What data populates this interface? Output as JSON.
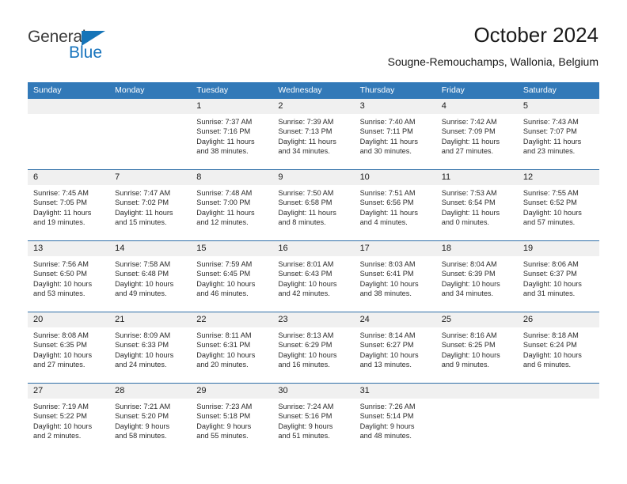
{
  "brand": {
    "name_primary": "General",
    "name_secondary": "Blue",
    "triangle_color": "#1574b8",
    "primary_color": "#3d3d3d",
    "secondary_color": "#1874bd"
  },
  "header": {
    "title": "October 2024",
    "subtitle": "Sougne-Remouchamps, Wallonia, Belgium"
  },
  "theme": {
    "header_blue": "#3279b8",
    "separator_blue": "#2f6fa8",
    "date_band_gray": "#f0f0f0",
    "text_color": "#2b2b2b"
  },
  "weekdays": [
    "Sunday",
    "Monday",
    "Tuesday",
    "Wednesday",
    "Thursday",
    "Friday",
    "Saturday"
  ],
  "weeks": [
    [
      {
        "day": "",
        "sunrise": "",
        "sunset": "",
        "daylight_a": "",
        "daylight_b": ""
      },
      {
        "day": "",
        "sunrise": "",
        "sunset": "",
        "daylight_a": "",
        "daylight_b": ""
      },
      {
        "day": "1",
        "sunrise": "Sunrise: 7:37 AM",
        "sunset": "Sunset: 7:16 PM",
        "daylight_a": "Daylight: 11 hours",
        "daylight_b": "and 38 minutes."
      },
      {
        "day": "2",
        "sunrise": "Sunrise: 7:39 AM",
        "sunset": "Sunset: 7:13 PM",
        "daylight_a": "Daylight: 11 hours",
        "daylight_b": "and 34 minutes."
      },
      {
        "day": "3",
        "sunrise": "Sunrise: 7:40 AM",
        "sunset": "Sunset: 7:11 PM",
        "daylight_a": "Daylight: 11 hours",
        "daylight_b": "and 30 minutes."
      },
      {
        "day": "4",
        "sunrise": "Sunrise: 7:42 AM",
        "sunset": "Sunset: 7:09 PM",
        "daylight_a": "Daylight: 11 hours",
        "daylight_b": "and 27 minutes."
      },
      {
        "day": "5",
        "sunrise": "Sunrise: 7:43 AM",
        "sunset": "Sunset: 7:07 PM",
        "daylight_a": "Daylight: 11 hours",
        "daylight_b": "and 23 minutes."
      }
    ],
    [
      {
        "day": "6",
        "sunrise": "Sunrise: 7:45 AM",
        "sunset": "Sunset: 7:05 PM",
        "daylight_a": "Daylight: 11 hours",
        "daylight_b": "and 19 minutes."
      },
      {
        "day": "7",
        "sunrise": "Sunrise: 7:47 AM",
        "sunset": "Sunset: 7:02 PM",
        "daylight_a": "Daylight: 11 hours",
        "daylight_b": "and 15 minutes."
      },
      {
        "day": "8",
        "sunrise": "Sunrise: 7:48 AM",
        "sunset": "Sunset: 7:00 PM",
        "daylight_a": "Daylight: 11 hours",
        "daylight_b": "and 12 minutes."
      },
      {
        "day": "9",
        "sunrise": "Sunrise: 7:50 AM",
        "sunset": "Sunset: 6:58 PM",
        "daylight_a": "Daylight: 11 hours",
        "daylight_b": "and 8 minutes."
      },
      {
        "day": "10",
        "sunrise": "Sunrise: 7:51 AM",
        "sunset": "Sunset: 6:56 PM",
        "daylight_a": "Daylight: 11 hours",
        "daylight_b": "and 4 minutes."
      },
      {
        "day": "11",
        "sunrise": "Sunrise: 7:53 AM",
        "sunset": "Sunset: 6:54 PM",
        "daylight_a": "Daylight: 11 hours",
        "daylight_b": "and 0 minutes."
      },
      {
        "day": "12",
        "sunrise": "Sunrise: 7:55 AM",
        "sunset": "Sunset: 6:52 PM",
        "daylight_a": "Daylight: 10 hours",
        "daylight_b": "and 57 minutes."
      }
    ],
    [
      {
        "day": "13",
        "sunrise": "Sunrise: 7:56 AM",
        "sunset": "Sunset: 6:50 PM",
        "daylight_a": "Daylight: 10 hours",
        "daylight_b": "and 53 minutes."
      },
      {
        "day": "14",
        "sunrise": "Sunrise: 7:58 AM",
        "sunset": "Sunset: 6:48 PM",
        "daylight_a": "Daylight: 10 hours",
        "daylight_b": "and 49 minutes."
      },
      {
        "day": "15",
        "sunrise": "Sunrise: 7:59 AM",
        "sunset": "Sunset: 6:45 PM",
        "daylight_a": "Daylight: 10 hours",
        "daylight_b": "and 46 minutes."
      },
      {
        "day": "16",
        "sunrise": "Sunrise: 8:01 AM",
        "sunset": "Sunset: 6:43 PM",
        "daylight_a": "Daylight: 10 hours",
        "daylight_b": "and 42 minutes."
      },
      {
        "day": "17",
        "sunrise": "Sunrise: 8:03 AM",
        "sunset": "Sunset: 6:41 PM",
        "daylight_a": "Daylight: 10 hours",
        "daylight_b": "and 38 minutes."
      },
      {
        "day": "18",
        "sunrise": "Sunrise: 8:04 AM",
        "sunset": "Sunset: 6:39 PM",
        "daylight_a": "Daylight: 10 hours",
        "daylight_b": "and 34 minutes."
      },
      {
        "day": "19",
        "sunrise": "Sunrise: 8:06 AM",
        "sunset": "Sunset: 6:37 PM",
        "daylight_a": "Daylight: 10 hours",
        "daylight_b": "and 31 minutes."
      }
    ],
    [
      {
        "day": "20",
        "sunrise": "Sunrise: 8:08 AM",
        "sunset": "Sunset: 6:35 PM",
        "daylight_a": "Daylight: 10 hours",
        "daylight_b": "and 27 minutes."
      },
      {
        "day": "21",
        "sunrise": "Sunrise: 8:09 AM",
        "sunset": "Sunset: 6:33 PM",
        "daylight_a": "Daylight: 10 hours",
        "daylight_b": "and 24 minutes."
      },
      {
        "day": "22",
        "sunrise": "Sunrise: 8:11 AM",
        "sunset": "Sunset: 6:31 PM",
        "daylight_a": "Daylight: 10 hours",
        "daylight_b": "and 20 minutes."
      },
      {
        "day": "23",
        "sunrise": "Sunrise: 8:13 AM",
        "sunset": "Sunset: 6:29 PM",
        "daylight_a": "Daylight: 10 hours",
        "daylight_b": "and 16 minutes."
      },
      {
        "day": "24",
        "sunrise": "Sunrise: 8:14 AM",
        "sunset": "Sunset: 6:27 PM",
        "daylight_a": "Daylight: 10 hours",
        "daylight_b": "and 13 minutes."
      },
      {
        "day": "25",
        "sunrise": "Sunrise: 8:16 AM",
        "sunset": "Sunset: 6:25 PM",
        "daylight_a": "Daylight: 10 hours",
        "daylight_b": "and 9 minutes."
      },
      {
        "day": "26",
        "sunrise": "Sunrise: 8:18 AM",
        "sunset": "Sunset: 6:24 PM",
        "daylight_a": "Daylight: 10 hours",
        "daylight_b": "and 6 minutes."
      }
    ],
    [
      {
        "day": "27",
        "sunrise": "Sunrise: 7:19 AM",
        "sunset": "Sunset: 5:22 PM",
        "daylight_a": "Daylight: 10 hours",
        "daylight_b": "and 2 minutes."
      },
      {
        "day": "28",
        "sunrise": "Sunrise: 7:21 AM",
        "sunset": "Sunset: 5:20 PM",
        "daylight_a": "Daylight: 9 hours",
        "daylight_b": "and 58 minutes."
      },
      {
        "day": "29",
        "sunrise": "Sunrise: 7:23 AM",
        "sunset": "Sunset: 5:18 PM",
        "daylight_a": "Daylight: 9 hours",
        "daylight_b": "and 55 minutes."
      },
      {
        "day": "30",
        "sunrise": "Sunrise: 7:24 AM",
        "sunset": "Sunset: 5:16 PM",
        "daylight_a": "Daylight: 9 hours",
        "daylight_b": "and 51 minutes."
      },
      {
        "day": "31",
        "sunrise": "Sunrise: 7:26 AM",
        "sunset": "Sunset: 5:14 PM",
        "daylight_a": "Daylight: 9 hours",
        "daylight_b": "and 48 minutes."
      },
      {
        "day": "",
        "sunrise": "",
        "sunset": "",
        "daylight_a": "",
        "daylight_b": ""
      },
      {
        "day": "",
        "sunrise": "",
        "sunset": "",
        "daylight_a": "",
        "daylight_b": ""
      }
    ]
  ]
}
